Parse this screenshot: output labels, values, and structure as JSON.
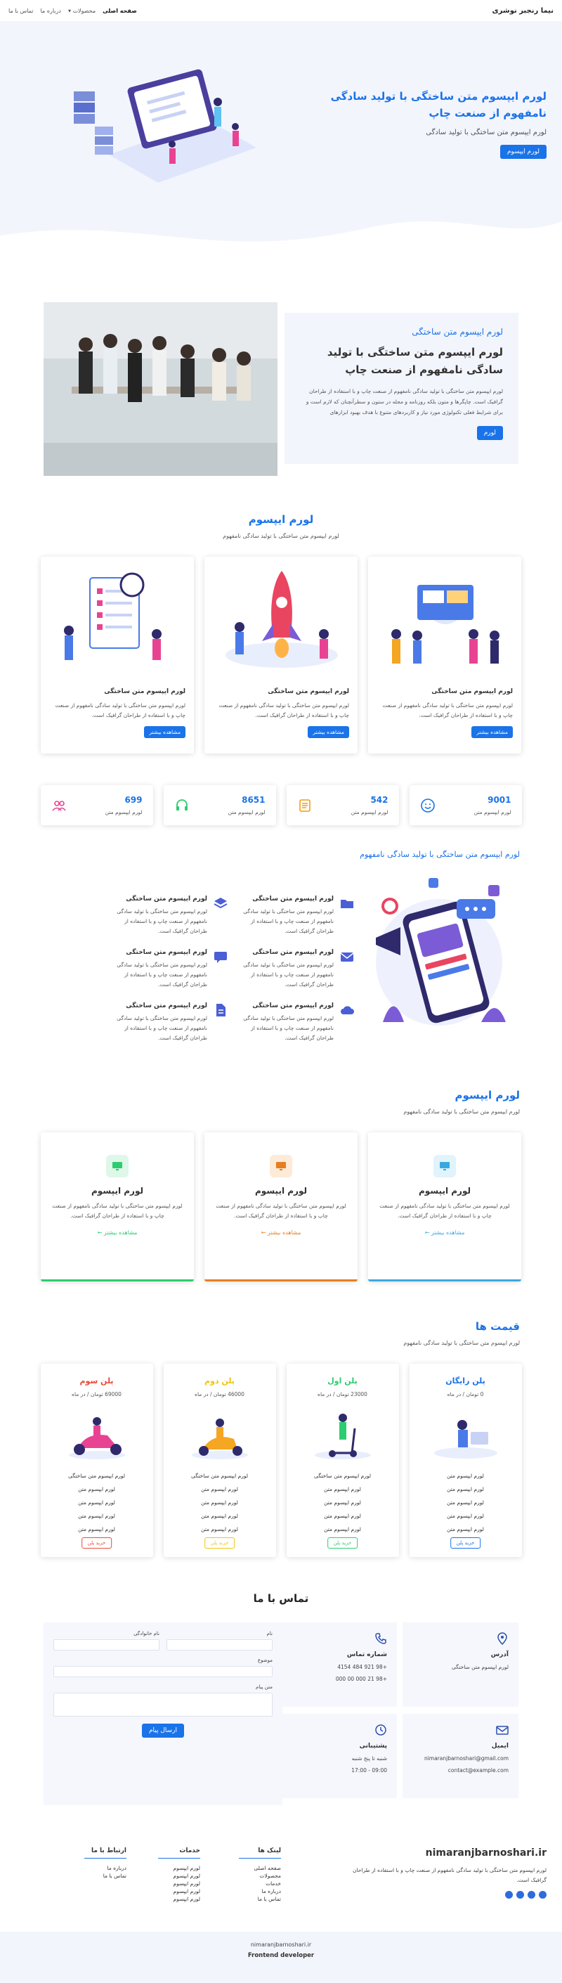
{
  "header": {
    "brand": "نیما رنجبر نوشری",
    "nav": [
      {
        "label": "صفحه اصلی"
      },
      {
        "label": "محصولات ▾"
      },
      {
        "label": "درباره ما"
      },
      {
        "label": "تماس با ما"
      }
    ]
  },
  "hero": {
    "title": "لورم ایپسوم متن ساختگی با تولید سادگی نامفهوم از صنعت چاپ",
    "subtitle": "لورم ایپسوم متن ساختگی با تولید سادگی",
    "button": "لورم ایپسوم"
  },
  "about": {
    "kicker": "لورم ایپسوم متن ساختگی",
    "title": "لورم ایپسوم متن ساختگی با تولید سادگی نامفهوم از صنعت چاپ",
    "text": "لورم ایپسوم متن ساختگی با تولید سادگی نامفهوم از صنعت چاپ و با استفاده از طراحان گرافیک است. چاپگرها و متون بلکه روزنامه و مجله در ستون و سطرآنچنان که لازم است و برای شرایط فعلی تکنولوژی مورد نیاز و کاربردهای متنوع با هدف بهبود ابزارهای",
    "button": "لورم"
  },
  "features": {
    "title": "لورم ایپسوم",
    "subtitle": "لورم ایپسوم متن ساختگی با تولید سادگی نامفهوم",
    "cards": [
      {
        "title": "لورم ایپسوم متن ساختگی",
        "text": "لورم ایپسوم متن ساختگی با تولید سادگی نامفهوم از صنعت چاپ و با استفاده از طراحان گرافیک است.",
        "button": "مشاهده بیشتر"
      },
      {
        "title": "لورم ایپسوم متن ساختگی",
        "text": "لورم ایپسوم متن ساختگی با تولید سادگی نامفهوم از صنعت چاپ و با استفاده از طراحان گرافیک است.",
        "button": "مشاهده بیشتر"
      },
      {
        "title": "لورم ایپسوم متن ساختگی",
        "text": "لورم ایپسوم متن ساختگی با تولید سادگی نامفهوم از صنعت چاپ و با استفاده از طراحان گرافیک است.",
        "button": "مشاهده بیشتر"
      }
    ]
  },
  "stats": [
    {
      "num": "9001",
      "label": "لورم ایپسوم متن",
      "icon": "smile-icon",
      "color": "#1a73e8"
    },
    {
      "num": "542",
      "label": "لورم ایپسوم متن",
      "icon": "list-icon",
      "color": "#f39c12"
    },
    {
      "num": "8651",
      "label": "لورم ایپسوم متن",
      "icon": "headset-icon",
      "color": "#2ecc71"
    },
    {
      "num": "699",
      "label": "لورم ایپسوم متن",
      "icon": "users-icon",
      "color": "#e84393"
    }
  ],
  "services": {
    "title": "لورم ایپسوم متن ساختگی با تولید سادگی نامفهوم",
    "items": [
      {
        "title": "لورم ایپسوم متن ساختگی",
        "text": "لورم ایپسوم متن ساختگی با تولید سادگی نامفهوم از صنعت چاپ و با استفاده از طراحان گرافیک است."
      },
      {
        "title": "لورم ایپسوم متن ساختگی",
        "text": "لورم ایپسوم متن ساختگی با تولید سادگی نامفهوم از صنعت چاپ و با استفاده از طراحان گرافیک است."
      },
      {
        "title": "لورم ایپسوم متن ساختگی",
        "text": "لورم ایپسوم متن ساختگی با تولید سادگی نامفهوم از صنعت چاپ و با استفاده از طراحان گرافیک است."
      },
      {
        "title": "لورم ایپسوم متن ساختگی",
        "text": "لورم ایپسوم متن ساختگی با تولید سادگی نامفهوم از صنعت چاپ و با استفاده از طراحان گرافیک است."
      },
      {
        "title": "لورم ایپسوم متن ساختگی",
        "text": "لورم ایپسوم متن ساختگی با تولید سادگی نامفهوم از صنعت چاپ و با استفاده از طراحان گرافیک است."
      },
      {
        "title": "لورم ایپسوم متن ساختگی",
        "text": "لورم ایپسوم متن ساختگی با تولید سادگی نامفهوم از صنعت چاپ و با استفاده از طراحان گرافیک است."
      }
    ]
  },
  "lorem": {
    "title": "لورم ایپسوم",
    "subtitle": "لورم ایپسوم متن ساختگی با تولید سادگی نامفهوم",
    "cards": [
      {
        "title": "لورم ایپسوم",
        "text": "لورم ایپسوم متن ساختگی با تولید سادگی نامفهوم از صنعت چاپ و با استفاده از طراحان گرافیک است.",
        "more": "مشاهده بیشتر ←",
        "color": "#3aa8e0",
        "bg": "#e1f3fb"
      },
      {
        "title": "لورم ایپسوم",
        "text": "لورم ایپسوم متن ساختگی با تولید سادگی نامفهوم از صنعت چاپ و با استفاده از طراحان گرافیک است.",
        "more": "مشاهده بیشتر ←",
        "color": "#e67e22",
        "bg": "#fdebd8"
      },
      {
        "title": "لورم ایپسوم",
        "text": "لورم ایپسوم متن ساختگی با تولید سادگی نامفهوم از صنعت چاپ و با استفاده از طراحان گرافیک است.",
        "more": "مشاهده بیشتر ←",
        "color": "#2ecc71",
        "bg": "#dff7e8"
      }
    ]
  },
  "pricing": {
    "title": "قیمت ها",
    "subtitle": "لورم ایپسوم متن ساختگی با تولید سادگی نامفهوم",
    "plans": [
      {
        "name": "پلن رایگان",
        "price": "0 تومان / در ماه",
        "color": "#1a73e8",
        "features": [
          "لورم ایپسوم متن",
          "لورم ایپسوم متن",
          "لورم ایپسوم متن",
          "لورم ایپسوم متن",
          "لورم ایپسوم متن"
        ],
        "button": "خرید پلن"
      },
      {
        "name": "پلن اول",
        "price": "23000 تومان / در ماه",
        "color": "#2ecc71",
        "features": [
          "لورم ایپسوم متن ساختگی",
          "لورم ایپسوم متن",
          "لورم ایپسوم متن",
          "لورم ایپسوم متن",
          "لورم ایپسوم متن"
        ],
        "button": "خرید پلن"
      },
      {
        "name": "پلن دوم",
        "price": "46000 تومان / در ماه",
        "color": "#f1c40f",
        "features": [
          "لورم ایپسوم متن ساختگی",
          "لورم ایپسوم متن",
          "لورم ایپسوم متن",
          "لورم ایپسوم متن",
          "لورم ایپسوم متن"
        ],
        "button": "خرید پلن"
      },
      {
        "name": "پلن سوم",
        "price": "69000 تومان / در ماه",
        "color": "#e74c3c",
        "features": [
          "لورم ایپسوم متن ساختگی",
          "لورم ایپسوم متن",
          "لورم ایپسوم متن",
          "لورم ایپسوم متن",
          "لورم ایپسوم متن"
        ],
        "button": "خرید پلن"
      }
    ]
  },
  "contact": {
    "title": "تماس با ما",
    "address": {
      "title": "آدرس",
      "text": "لورم ایپسوم متن ساختگی"
    },
    "phone": {
      "title": "شماره تماس",
      "lines": [
        "+98 921 484 4154",
        "+98 21 000 00 000"
      ]
    },
    "email": {
      "title": "ایمیل",
      "lines": [
        "nimaranjbarnoshari@gmail.com",
        "contact@example.com"
      ]
    },
    "support": {
      "title": "پشتیبانی",
      "lines": [
        "شنبه تا پنج شنبه",
        "09:00 - 17:00"
      ]
    },
    "form": {
      "name": "نام",
      "family": "نام خانوادگی",
      "subject": "موضوع",
      "message": "متن پیام",
      "submit": "ارسال پیام"
    }
  },
  "footer": {
    "brand": "nimaranjbarnoshari.ir",
    "text": "لورم ایپسوم متن ساختگی با تولید سادگی نامفهوم از صنعت چاپ و با استفاده از طراحان گرافیک است.",
    "links": {
      "title": "لینک ها",
      "items": [
        "صفحه اصلی",
        "محصولات",
        "خدمات",
        "درباره ما",
        "تماس با ما"
      ]
    },
    "services": {
      "title": "خدمات",
      "items": [
        "لورم ایپسوم",
        "لورم ایپسوم",
        "لورم ایپسوم",
        "لورم ایپسوم",
        "لورم ایپسوم"
      ]
    },
    "contact": {
      "title": "ارتباط با ما",
      "items": [
        "درباره ما",
        "تماس با ما"
      ]
    },
    "copy": "nimaranjbarnoshari.ir",
    "role": "Frontend developer"
  }
}
